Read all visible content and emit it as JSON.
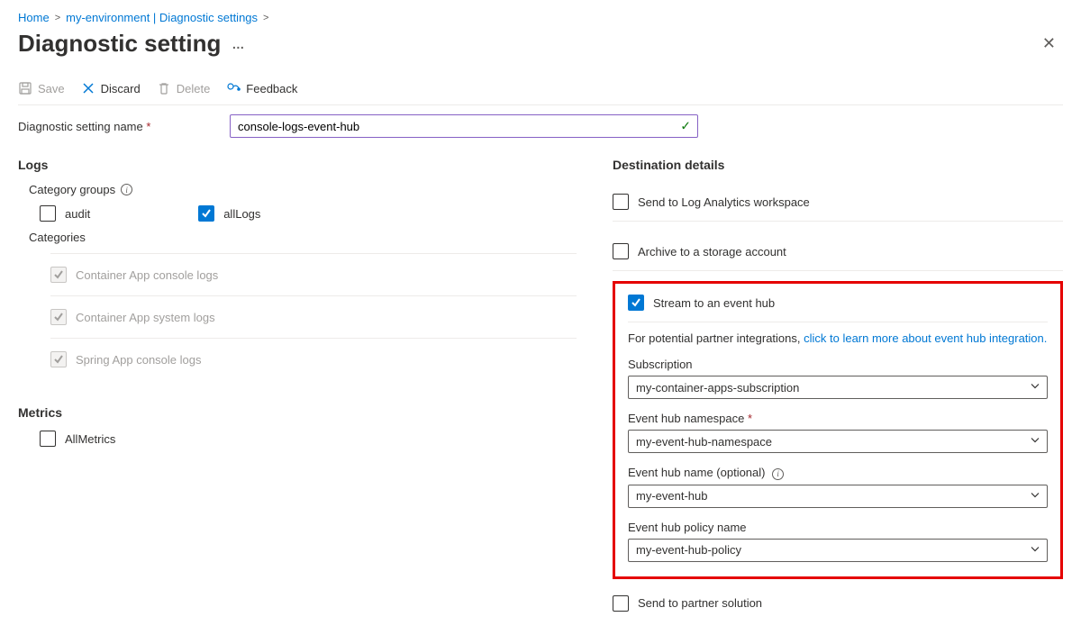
{
  "breadcrumb": {
    "home": "Home",
    "env": "my-environment | Diagnostic settings"
  },
  "title": "Diagnostic setting",
  "toolbar": {
    "save": "Save",
    "discard": "Discard",
    "delete": "Delete",
    "feedback": "Feedback"
  },
  "nameField": {
    "label": "Diagnostic setting name",
    "value": "console-logs-event-hub"
  },
  "logs": {
    "header": "Logs",
    "categoryGroupsLabel": "Category groups",
    "audit": "audit",
    "allLogs": "allLogs",
    "categoriesLabel": "Categories",
    "items": [
      "Container App console logs",
      "Container App system logs",
      "Spring App console logs"
    ]
  },
  "metrics": {
    "header": "Metrics",
    "allMetrics": "AllMetrics"
  },
  "destination": {
    "header": "Destination details",
    "logAnalytics": "Send to Log Analytics workspace",
    "storage": "Archive to a storage account",
    "eventHub": "Stream to an event hub",
    "partner": "Send to partner solution",
    "helperPrefix": "For potential partner integrations, ",
    "helperLink": "click to learn more about event hub integration.",
    "fields": {
      "subscription": {
        "label": "Subscription",
        "value": "my-container-apps-subscription"
      },
      "namespace": {
        "label": "Event hub namespace",
        "value": "my-event-hub-namespace"
      },
      "hubName": {
        "label": "Event hub name (optional)",
        "value": "my-event-hub"
      },
      "policy": {
        "label": "Event hub policy name",
        "value": "my-event-hub-policy"
      }
    }
  }
}
